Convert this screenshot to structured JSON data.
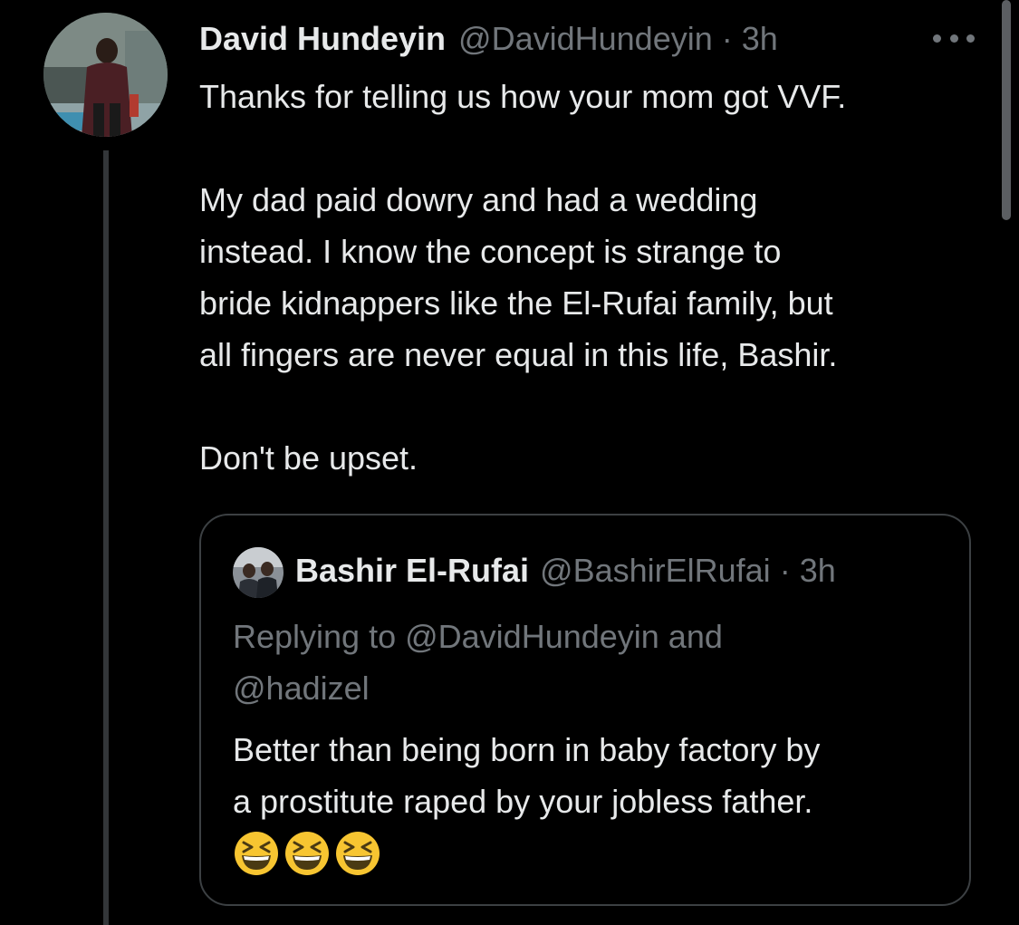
{
  "tweet": {
    "author": {
      "name": "David Hundeyin",
      "handle": "@DavidHundeyin",
      "separator": "·",
      "time": "3h"
    },
    "body_lines": [
      "Thanks for telling us how your mom got VVF.",
      "",
      "My dad paid dowry and had a wedding",
      "instead. I know the concept is strange to",
      "bride kidnappers like the El-Rufai family, but",
      "all fingers are never equal in this life, Bashir.",
      "",
      "Don't be upset."
    ],
    "more_icon": "more-horizontal-icon"
  },
  "quote": {
    "author": {
      "name": "Bashir El-Rufai",
      "handle": "@BashirElRufai",
      "separator": "·",
      "time": "3h"
    },
    "replying_line1": "Replying to @DavidHundeyin and",
    "replying_line2": "@hadizel",
    "body_line1": "Better than being born in baby factory by",
    "body_line2": "a prostitute raped by your jobless father.",
    "emoji": [
      "grinning-squinting-face-icon",
      "grinning-squinting-face-icon",
      "grinning-squinting-face-icon"
    ]
  },
  "colors": {
    "background": "#000000",
    "primary_text": "#e7e9ea",
    "secondary_text": "#71767b",
    "border": "#3c4043",
    "thread_line": "#333639"
  }
}
